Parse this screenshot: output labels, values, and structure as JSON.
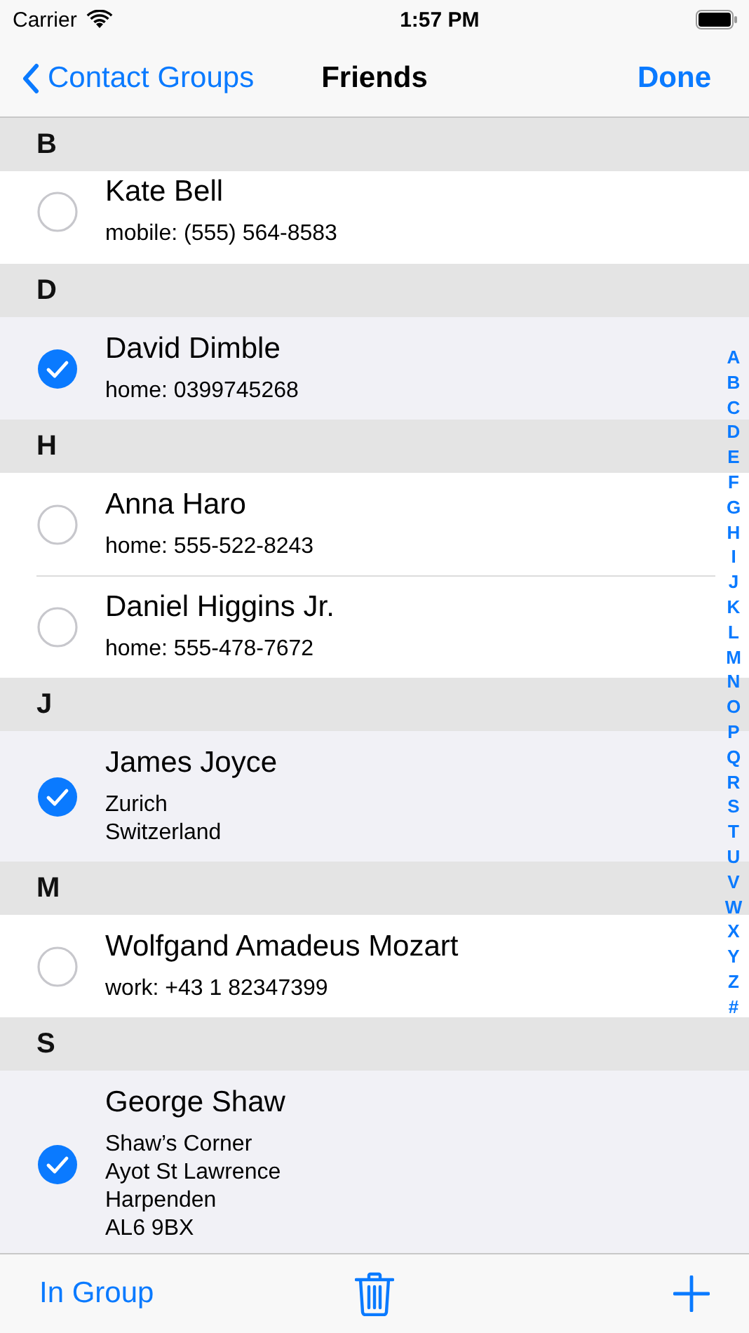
{
  "status_bar": {
    "carrier": "Carrier",
    "time": "1:57 PM"
  },
  "nav": {
    "back": "Contact Groups",
    "title": "Friends",
    "done": "Done"
  },
  "sections": [
    {
      "letter": "B",
      "contacts": [
        {
          "name": "Kate Bell",
          "details": [
            "mobile: (555) 564-8583"
          ],
          "selected": false
        }
      ]
    },
    {
      "letter": "D",
      "contacts": [
        {
          "name": "David Dimble",
          "details": [
            "home: 0399745268"
          ],
          "selected": true
        }
      ]
    },
    {
      "letter": "H",
      "contacts": [
        {
          "name": "Anna Haro",
          "details": [
            "home: 555-522-8243"
          ],
          "selected": false
        },
        {
          "name": "Daniel Higgins Jr.",
          "details": [
            "home: 555-478-7672"
          ],
          "selected": false
        }
      ]
    },
    {
      "letter": "J",
      "contacts": [
        {
          "name": "James Joyce",
          "details": [
            "Zurich",
            "Switzerland"
          ],
          "selected": true
        }
      ]
    },
    {
      "letter": "M",
      "contacts": [
        {
          "name": "Wolfgand Amadeus Mozart",
          "details": [
            "work: +43 1 82347399"
          ],
          "selected": false
        }
      ]
    },
    {
      "letter": "S",
      "contacts": [
        {
          "name": "George Shaw",
          "details": [
            "Shaw’s Corner",
            "Ayot St Lawrence",
            "Harpenden",
            "AL6 9BX"
          ],
          "selected": true
        }
      ]
    }
  ],
  "index": [
    "A",
    "B",
    "C",
    "D",
    "E",
    "F",
    "G",
    "H",
    "I",
    "J",
    "K",
    "L",
    "M",
    "N",
    "O",
    "P",
    "Q",
    "R",
    "S",
    "T",
    "U",
    "V",
    "W",
    "X",
    "Y",
    "Z",
    "#"
  ],
  "toolbar": {
    "left": "In Group"
  }
}
